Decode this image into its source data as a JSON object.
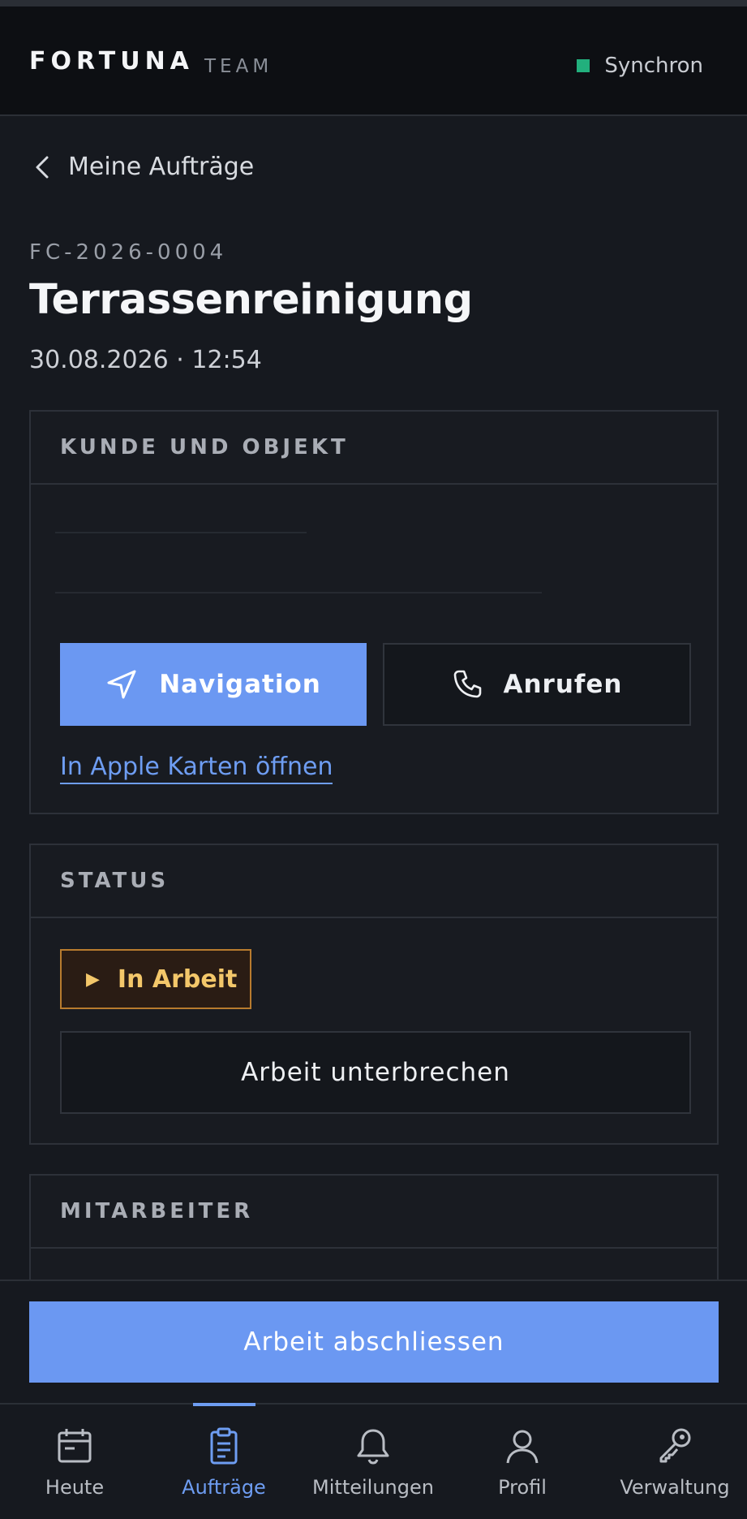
{
  "header": {
    "brand": "FORTUNA",
    "brand_sub": "TEAM",
    "sync_label": "Synchron",
    "sync_color": "#22b07d"
  },
  "back": {
    "label": "Meine Aufträge",
    "icon": "chevron-left-icon"
  },
  "order": {
    "number": "FC-2026-0004",
    "title": "Terrassenreinigung",
    "datetime": "30.08.2026 · 12:54"
  },
  "customer_card": {
    "heading": "KUNDE UND OBJEKT",
    "navigation_label": "Navigation",
    "call_label": "Anrufen",
    "apple_maps_link": "In Apple Karten öffnen"
  },
  "status_card": {
    "heading": "STATUS",
    "badge_icon": "▶",
    "badge_label": "In Arbeit",
    "pause_label": "Arbeit unterbrechen"
  },
  "staff_card": {
    "heading": "MITARBEITER"
  },
  "footer": {
    "complete_label": "Arbeit abschliessen"
  },
  "bottom_nav": {
    "items": [
      {
        "label": "Heute",
        "icon": "calendar-icon"
      },
      {
        "label": "Aufträge",
        "icon": "clipboard-icon",
        "active": true
      },
      {
        "label": "Mitteilungen",
        "icon": "bell-icon"
      },
      {
        "label": "Profil",
        "icon": "user-icon"
      },
      {
        "label": "Verwaltung",
        "icon": "key-icon"
      }
    ]
  },
  "colors": {
    "accent": "#6b98f2",
    "background": "#16191f",
    "status_in_progress": "#f3c76a"
  }
}
